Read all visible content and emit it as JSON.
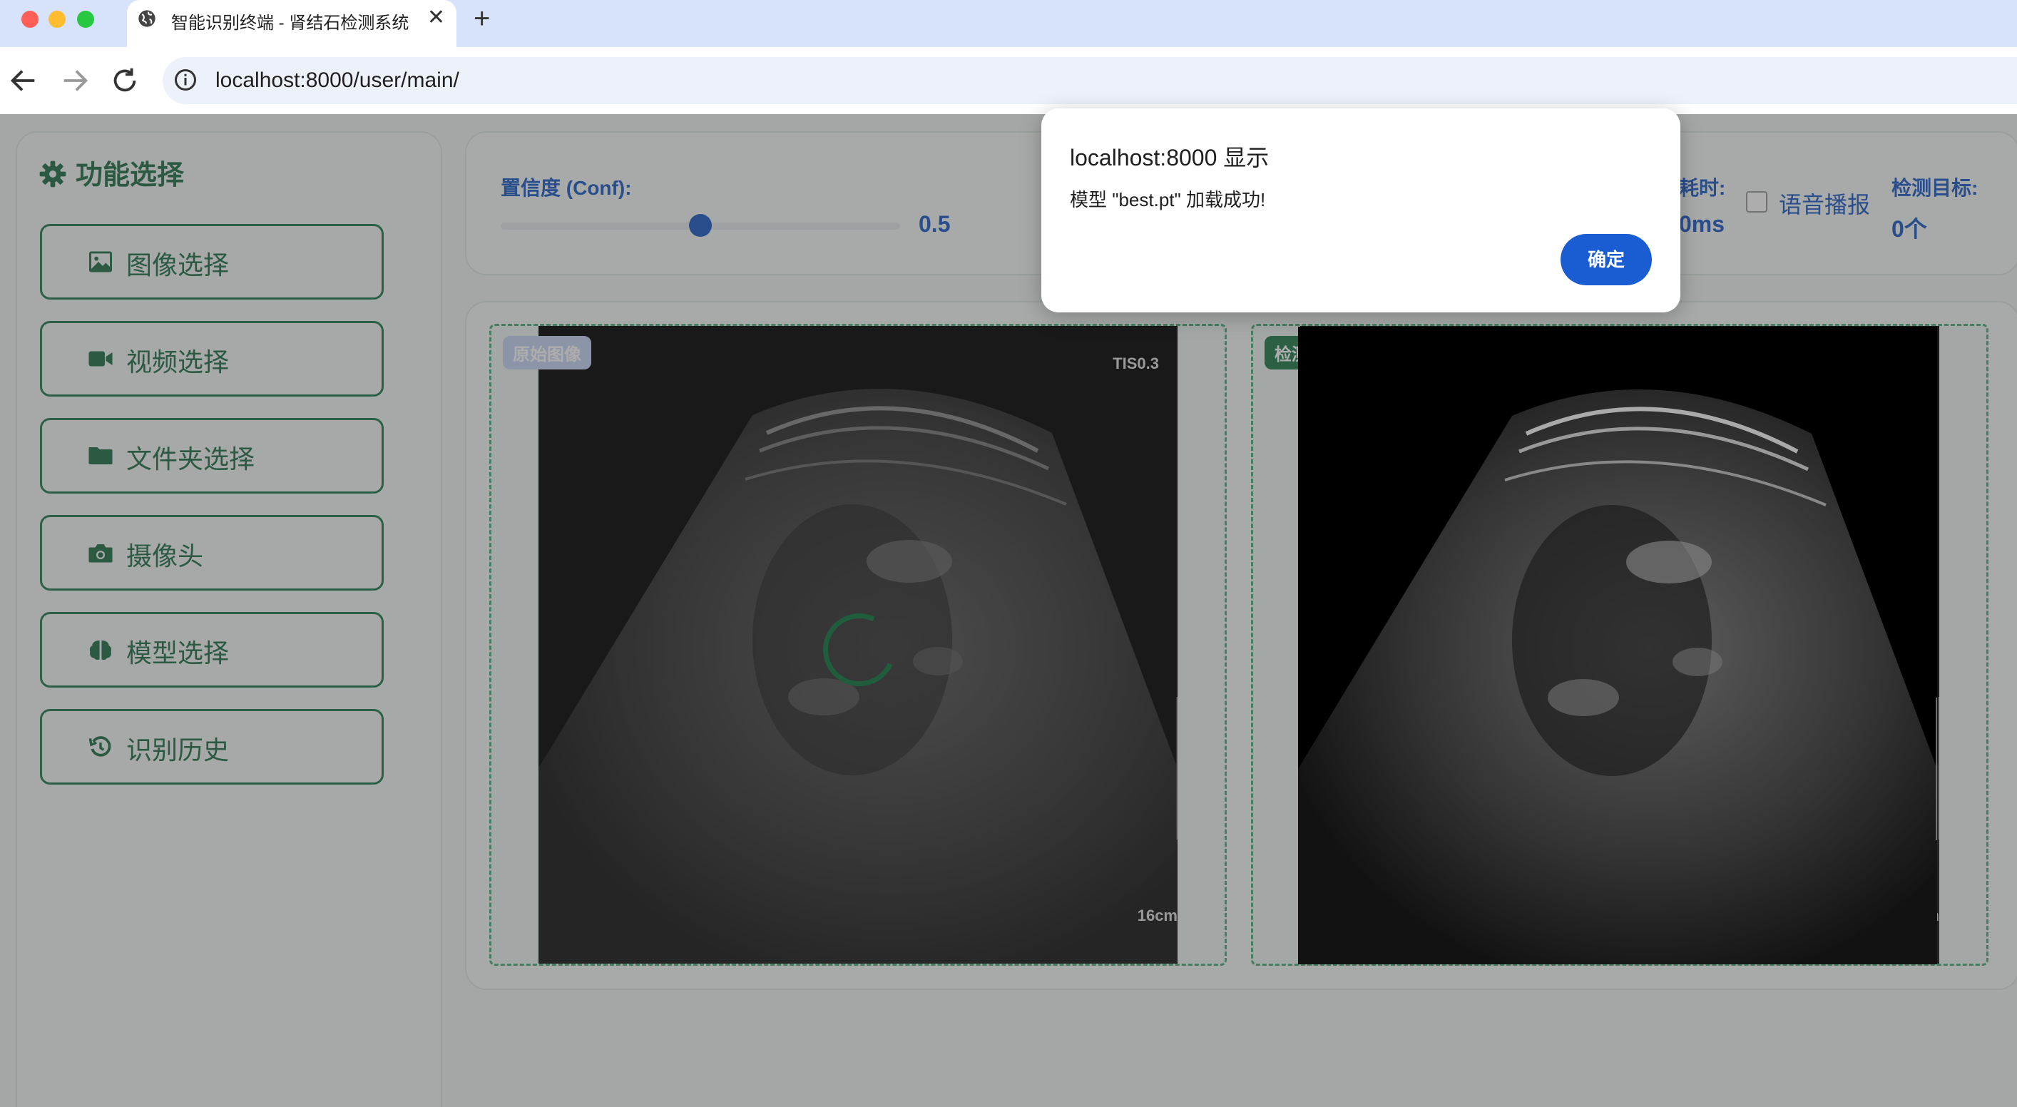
{
  "browser": {
    "tab_title": "智能识别终端 - 肾结石检测系统",
    "close_glyph": "✕",
    "new_tab_glyph": "+",
    "url": "localhost:8000/user/main/"
  },
  "sidebar": {
    "title": "功能选择",
    "items": [
      {
        "label": "图像选择",
        "icon": "image-icon"
      },
      {
        "label": "视频选择",
        "icon": "video-icon"
      },
      {
        "label": "文件夹选择",
        "icon": "folder-icon"
      },
      {
        "label": "摄像头",
        "icon": "camera-icon"
      },
      {
        "label": "模型选择",
        "icon": "brain-icon"
      },
      {
        "label": "识别历史",
        "icon": "history-icon"
      }
    ]
  },
  "controls": {
    "conf_label": "置信度 (Conf):",
    "conf_value": "0.5",
    "conf_fraction": 0.5,
    "time_label": "耗时:",
    "time_value": "0ms",
    "voice_label": "语音播报",
    "target_label": "检测目标:",
    "target_value": "0个"
  },
  "images": {
    "original_tag": "原始图像",
    "result_tag": "检测结果",
    "overlay_top": "TIS0.3",
    "overlay_bottom": "16cm"
  },
  "dialog": {
    "title": "localhost:8000 显示",
    "message": "模型 \"best.pt\" 加载成功!",
    "ok_label": "确定"
  },
  "colors": {
    "accent_green": "#1f6e47",
    "accent_blue": "#1e5bc6",
    "dialog_button": "#1a5cd2"
  }
}
